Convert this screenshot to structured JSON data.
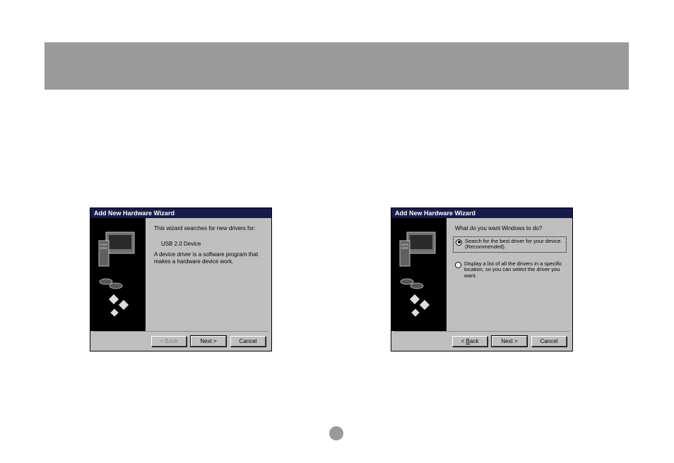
{
  "dialog1": {
    "title": "Add New Hardware Wizard",
    "intro": "This wizard searches for new drivers for:",
    "device": "USB 2.0 Device",
    "description": "A device driver is a software program that makes a hardware device work.",
    "buttons": {
      "back": "< Back",
      "next": "Next >",
      "cancel": "Cancel"
    }
  },
  "dialog2": {
    "title": "Add New Hardware Wizard",
    "question": "What do you want Windows to do?",
    "option1": "Search for the best driver for your device. (Recommended).",
    "option2": "Display a list of all the drivers in a specific location, so you can select the driver you want.",
    "buttons": {
      "back": "< Back",
      "next": "Next >",
      "cancel": "Cancel"
    }
  }
}
